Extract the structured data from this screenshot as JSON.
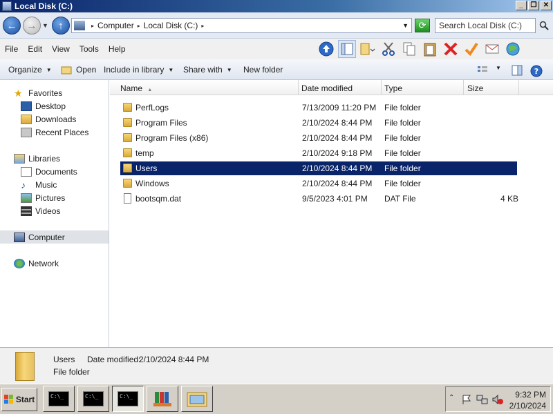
{
  "window": {
    "title": "Local Disk (C:)",
    "controls": {
      "minimize": "_",
      "maximize": "❐",
      "close": "✕"
    }
  },
  "address": {
    "crumbs": [
      "Computer",
      "Local Disk (C:)"
    ],
    "search_placeholder": "Search Local Disk (C:)"
  },
  "menu": [
    "File",
    "Edit",
    "View",
    "Tools",
    "Help"
  ],
  "commands": {
    "organize": "Organize",
    "open": "Open",
    "include": "Include in library",
    "share": "Share with",
    "new_folder": "New folder"
  },
  "nav": {
    "favorites": "Favorites",
    "desktop": "Desktop",
    "downloads": "Downloads",
    "recent": "Recent Places",
    "libraries": "Libraries",
    "documents": "Documents",
    "music": "Music",
    "pictures": "Pictures",
    "videos": "Videos",
    "computer": "Computer",
    "network": "Network"
  },
  "columns": {
    "name": "Name",
    "date": "Date modified",
    "type": "Type",
    "size": "Size"
  },
  "files": [
    {
      "name": "PerfLogs",
      "date": "7/13/2009 11:20 PM",
      "type": "File folder",
      "size": "",
      "kind": "folder"
    },
    {
      "name": "Program Files",
      "date": "2/10/2024 8:44 PM",
      "type": "File folder",
      "size": "",
      "kind": "folder"
    },
    {
      "name": "Program Files (x86)",
      "date": "2/10/2024 8:44 PM",
      "type": "File folder",
      "size": "",
      "kind": "folder"
    },
    {
      "name": "temp",
      "date": "2/10/2024 9:18 PM",
      "type": "File folder",
      "size": "",
      "kind": "folder"
    },
    {
      "name": "Users",
      "date": "2/10/2024 8:44 PM",
      "type": "File folder",
      "size": "",
      "kind": "folder",
      "selected": true
    },
    {
      "name": "Windows",
      "date": "2/10/2024 8:44 PM",
      "type": "File folder",
      "size": "",
      "kind": "folder"
    },
    {
      "name": "bootsqm.dat",
      "date": "9/5/2023 4:01 PM",
      "type": "DAT File",
      "size": "4 KB",
      "kind": "file"
    }
  ],
  "details": {
    "name": "Users",
    "date_label": "Date modified:",
    "date_value": "2/10/2024 8:44 PM",
    "type": "File folder"
  },
  "taskbar": {
    "start": "Start",
    "cmd_glyph": "C:\\_",
    "time": "9:32 PM",
    "date": "2/10/2024"
  },
  "colors": {
    "selection": "#0a246a",
    "title_start": "#0a246a",
    "title_end": "#a6caf0"
  }
}
